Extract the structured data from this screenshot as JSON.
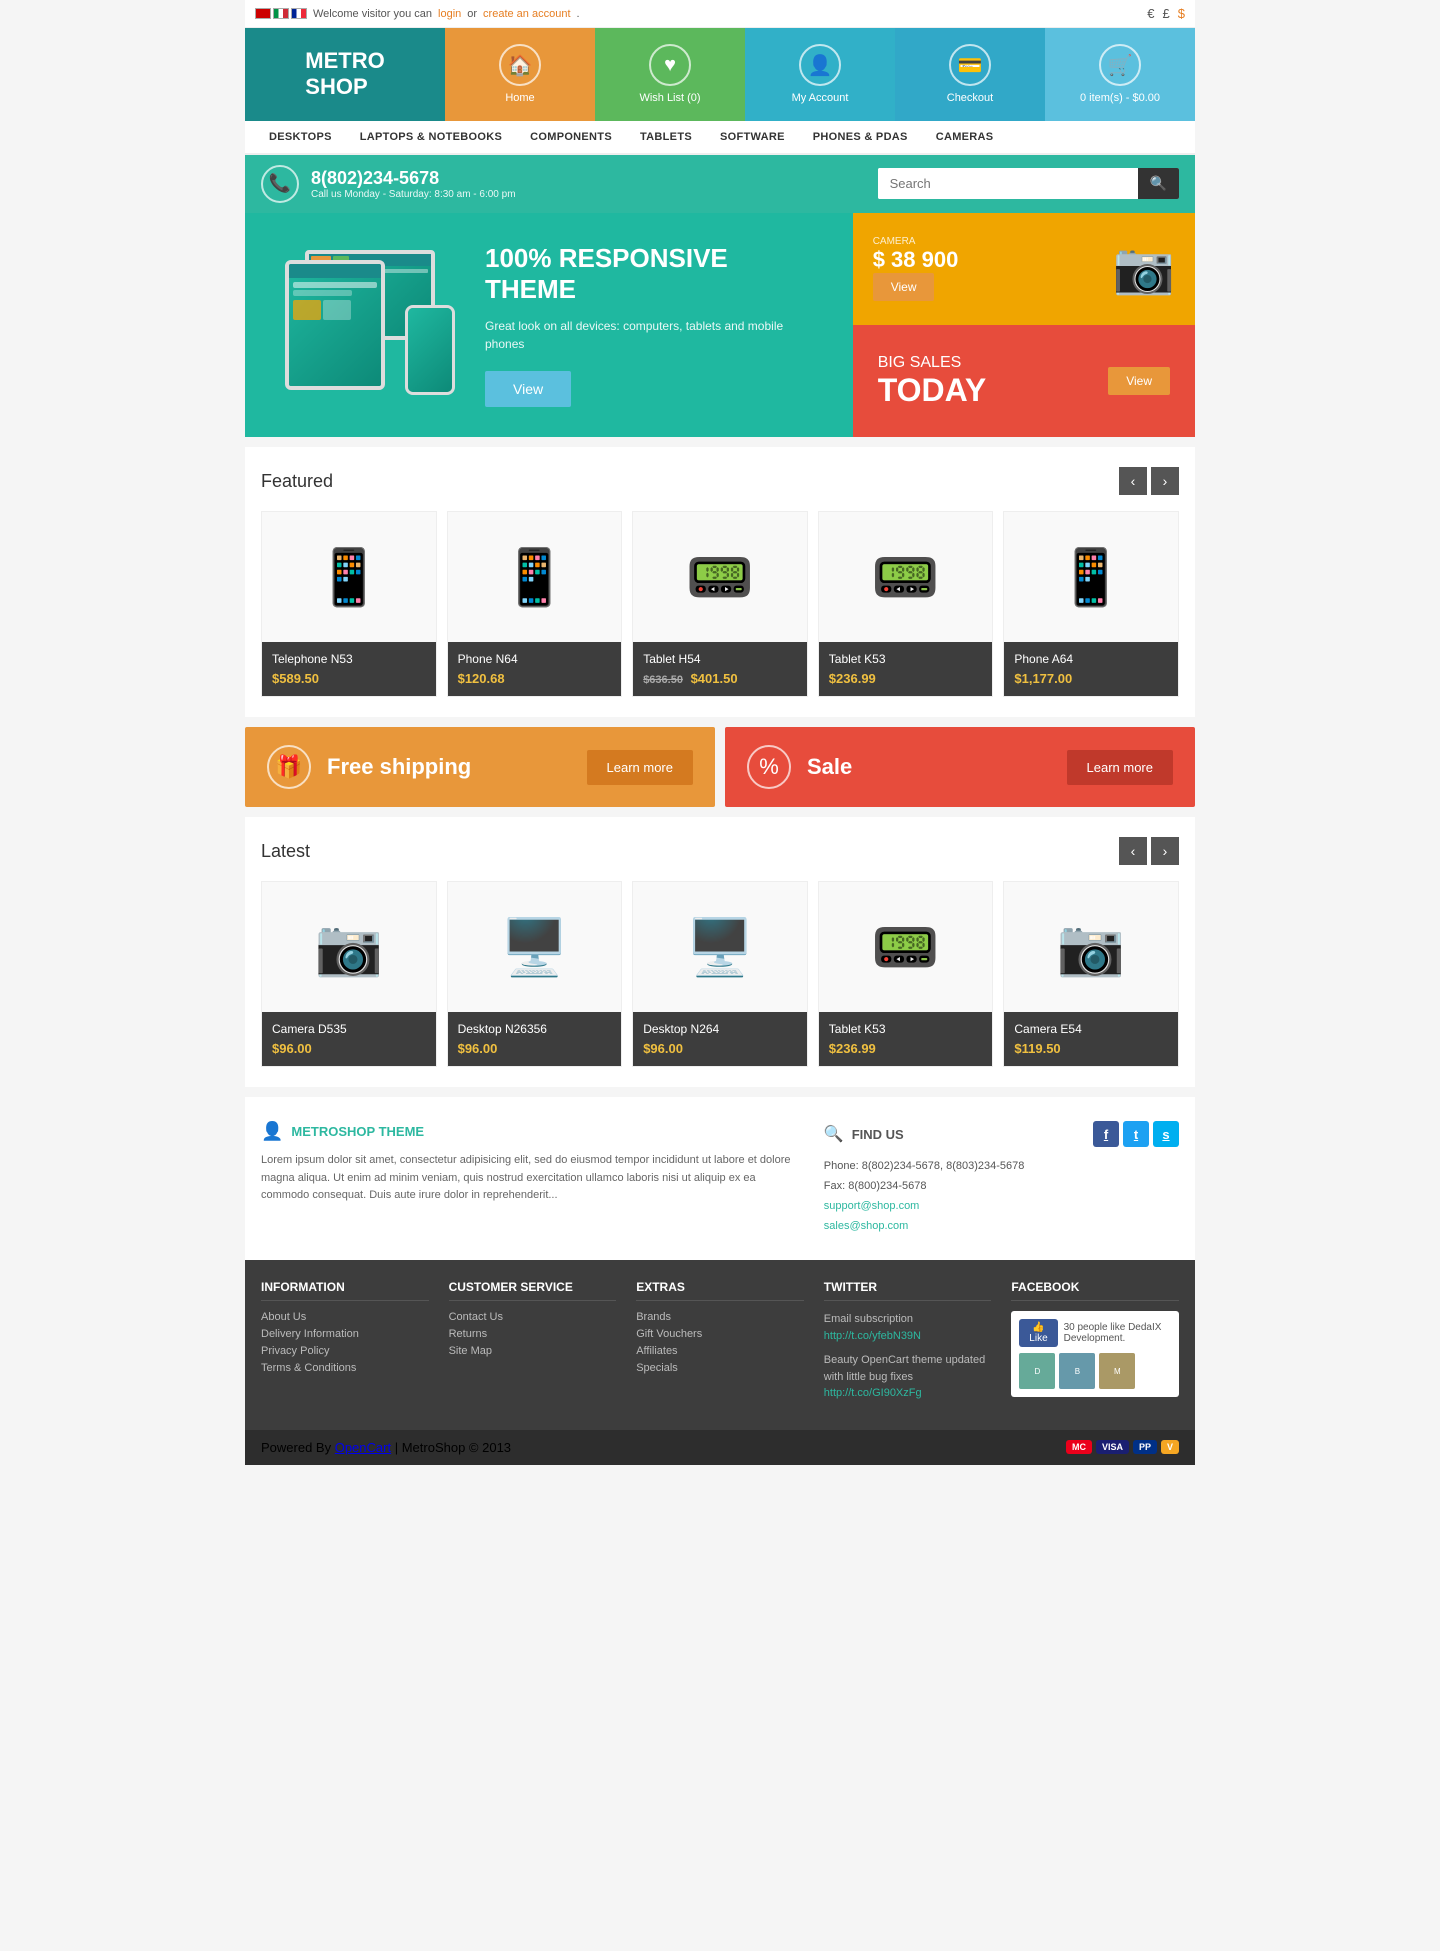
{
  "topbar": {
    "welcome_text": "Welcome visitor you can",
    "login_text": "login",
    "or_text": "or",
    "register_text": "create an account",
    "currencies": [
      "€",
      "£",
      "$"
    ]
  },
  "header": {
    "logo_line1": "METRO",
    "logo_line2": "SHOP",
    "nav_items": [
      {
        "icon": "🏠",
        "label": "Home"
      },
      {
        "icon": "♥",
        "label": "Wish List (0)"
      },
      {
        "icon": "👤",
        "label": "My Account"
      },
      {
        "icon": "💳",
        "label": "Checkout"
      },
      {
        "icon": "🛒",
        "label": "0 item(s) - $0.00"
      }
    ]
  },
  "nav_menu": {
    "items": [
      "DESKTOPS",
      "LAPTOPS & NOTEBOOKS",
      "COMPONENTS",
      "TABLETS",
      "SOFTWARE",
      "PHONES & PDAS",
      "CAMERAS"
    ]
  },
  "phone_bar": {
    "number": "8(802)234-5678",
    "hours": "Call us Monday - Saturday: 8:30 am - 6:00 pm",
    "search_placeholder": "Search"
  },
  "hero": {
    "title": "100% RESPONSIVE THEME",
    "description": "Great look on all devices: computers, tablets and mobile phones",
    "view_btn": "View",
    "camera": {
      "label": "CAMERA",
      "price": "$ 38 900",
      "btn": "View"
    },
    "sale": {
      "line1": "BIG SALES",
      "line2": "TODAY",
      "btn": "View"
    }
  },
  "featured": {
    "title": "Featured",
    "products": [
      {
        "name": "Telephone N53",
        "price": "$589.50",
        "old_price": null,
        "icon": "📱"
      },
      {
        "name": "Phone N64",
        "price": "$120.68",
        "old_price": null,
        "icon": "📱"
      },
      {
        "name": "Tablet H54",
        "price": "$401.50",
        "old_price": "$636.50",
        "icon": "📟"
      },
      {
        "name": "Tablet K53",
        "price": "$236.99",
        "old_price": null,
        "icon": "📟"
      },
      {
        "name": "Phone A64",
        "price": "$1,177.00",
        "old_price": null,
        "icon": "📱"
      }
    ]
  },
  "promo": {
    "free_shipping": {
      "label": "Free shipping",
      "btn": "Learn more"
    },
    "sale": {
      "label": "Sale",
      "btn": "Learn more"
    }
  },
  "latest": {
    "title": "Latest",
    "products": [
      {
        "name": "Camera D535",
        "price": "$96.00",
        "old_price": null,
        "icon": "📷"
      },
      {
        "name": "Desktop N26356",
        "price": "$96.00",
        "old_price": null,
        "icon": "🖥️"
      },
      {
        "name": "Desktop N264",
        "price": "$96.00",
        "old_price": null,
        "icon": "🖥️"
      },
      {
        "name": "Tablet K53",
        "price": "$236.99",
        "old_price": null,
        "icon": "📟"
      },
      {
        "name": "Camera E54",
        "price": "$119.50",
        "old_price": null,
        "icon": "📷"
      }
    ]
  },
  "footer_about": {
    "title": "METROSHOP THEME",
    "text": "Lorem ipsum dolor sit amet, consectetur adipisicing elit, sed do eiusmod tempor incididunt ut labore et dolore magna aliqua. Ut enim ad minim veniam, quis nostrud exercitation ullamco laboris nisi ut aliquip ex ea commodo consequat. Duis aute irure dolor in reprehenderit..."
  },
  "footer_contact": {
    "title": "FIND US",
    "phone": "Phone: 8(802)234-5678, 8(803)234-5678",
    "fax": "Fax: 8(800)234-5678",
    "email1": "support@shop.com",
    "email2": "sales@shop.com"
  },
  "bottom_footer": {
    "columns": [
      {
        "title": "INFORMATION",
        "links": [
          "About Us",
          "Delivery Information",
          "Privacy Policy",
          "Terms & Conditions"
        ]
      },
      {
        "title": "CUSTOMER SERVICE",
        "links": [
          "Contact Us",
          "Returns",
          "Site Map"
        ]
      },
      {
        "title": "EXTRAS",
        "links": [
          "Brands",
          "Gift Vouchers",
          "Affiliates",
          "Specials"
        ]
      },
      {
        "title": "TWITTER",
        "items": [
          {
            "text": "Email subscription",
            "link": "http://t.co/yfebN39N"
          },
          {
            "text": "Beauty OpenCart theme updated with little bug fixes",
            "link": "http://t.co/GI90XzFg"
          }
        ]
      },
      {
        "title": "FACEBOOK",
        "like_text": "30 people like DedaIX Development.",
        "avatars": [
          "D",
          "B",
          "M"
        ]
      }
    ]
  },
  "very_bottom": {
    "powered": "Powered By",
    "opencart": "OpenCart",
    "copyright": "MetroShop © 2013",
    "payment_methods": [
      "MASTER",
      "VISA",
      "PayPal",
      "VISA"
    ]
  }
}
